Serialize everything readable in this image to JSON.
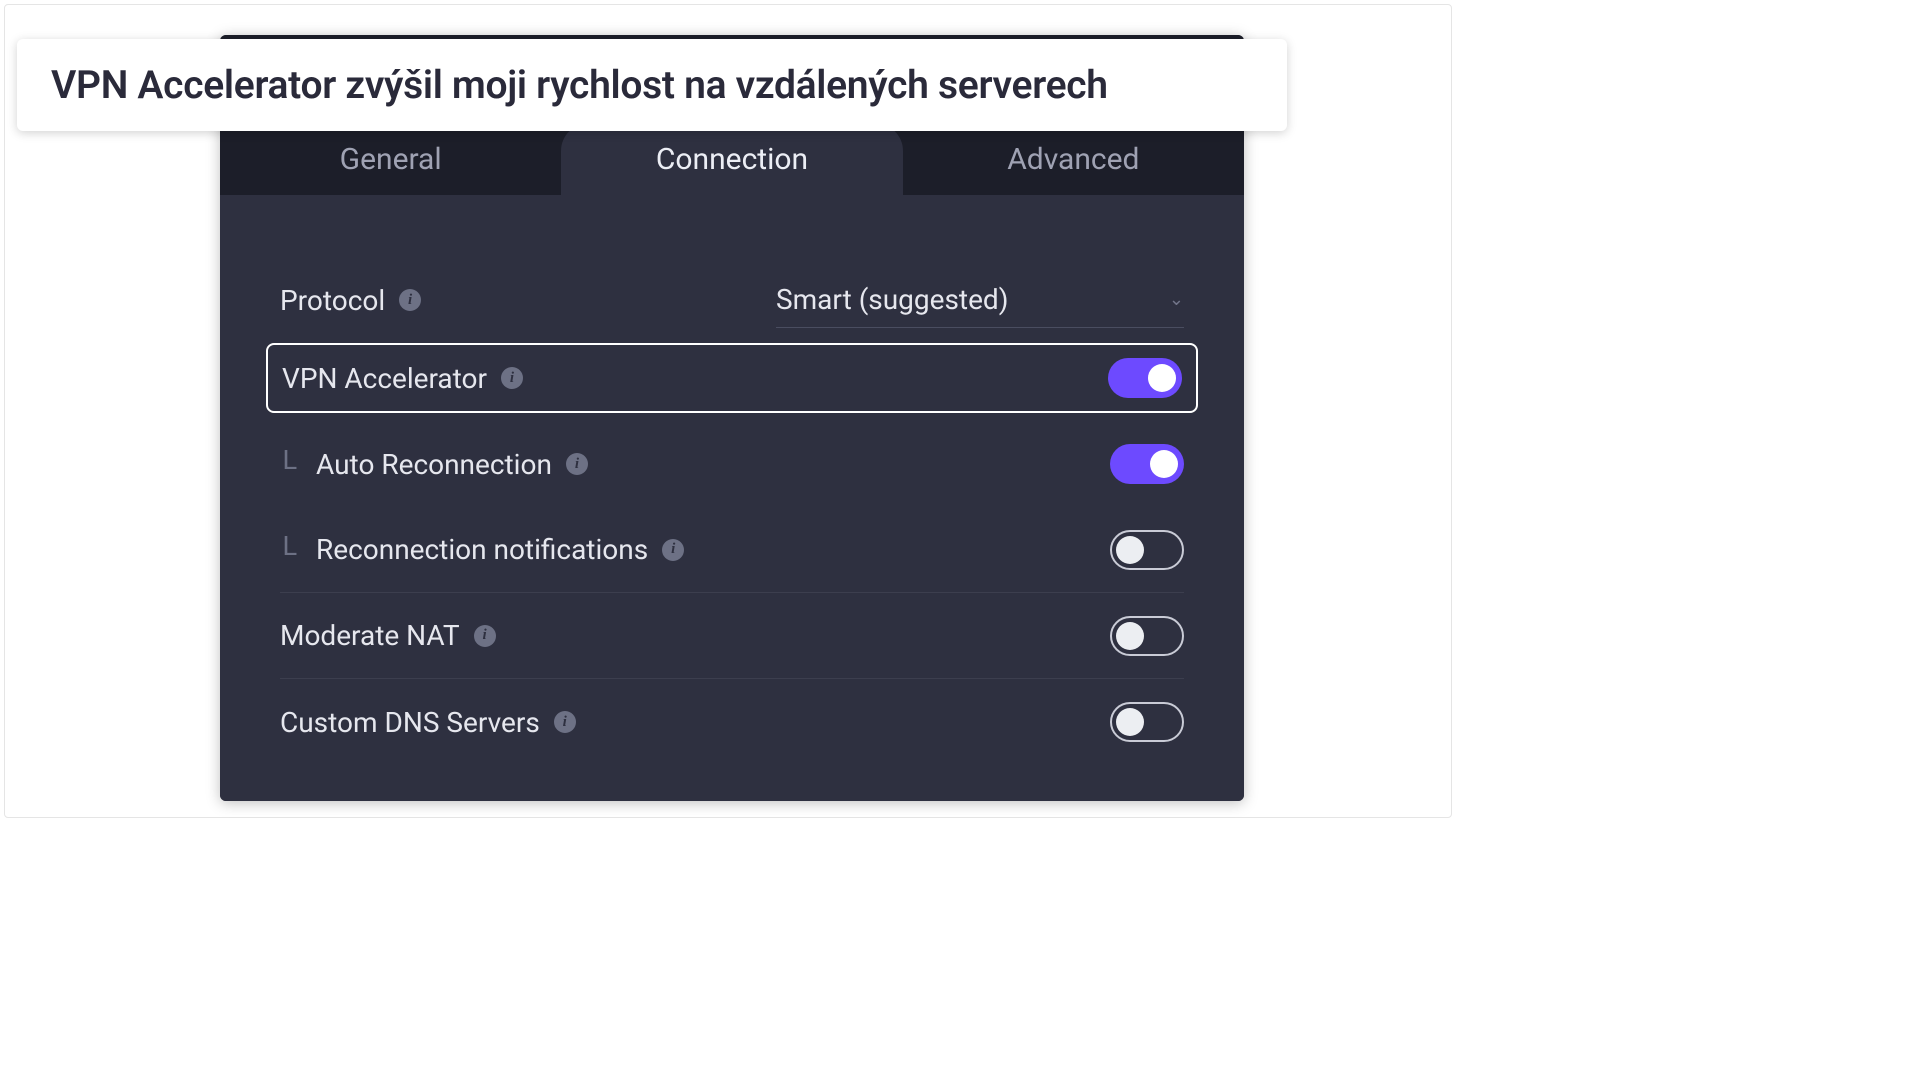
{
  "caption": "VPN Accelerator zvýšil moji rychlost na vzdálených serverech",
  "tabs": {
    "general": "General",
    "connection": "Connection",
    "advanced": "Advanced"
  },
  "settings": {
    "protocol": {
      "label": "Protocol",
      "value": "Smart (suggested)"
    },
    "vpn_accelerator": {
      "label": "VPN Accelerator",
      "on": true
    },
    "auto_reconnection": {
      "label": "Auto Reconnection",
      "on": true
    },
    "reconnection_notifications": {
      "label": "Reconnection notifications",
      "on": false
    },
    "moderate_nat": {
      "label": "Moderate NAT",
      "on": false
    },
    "custom_dns": {
      "label": "Custom DNS Servers",
      "on": false
    }
  }
}
